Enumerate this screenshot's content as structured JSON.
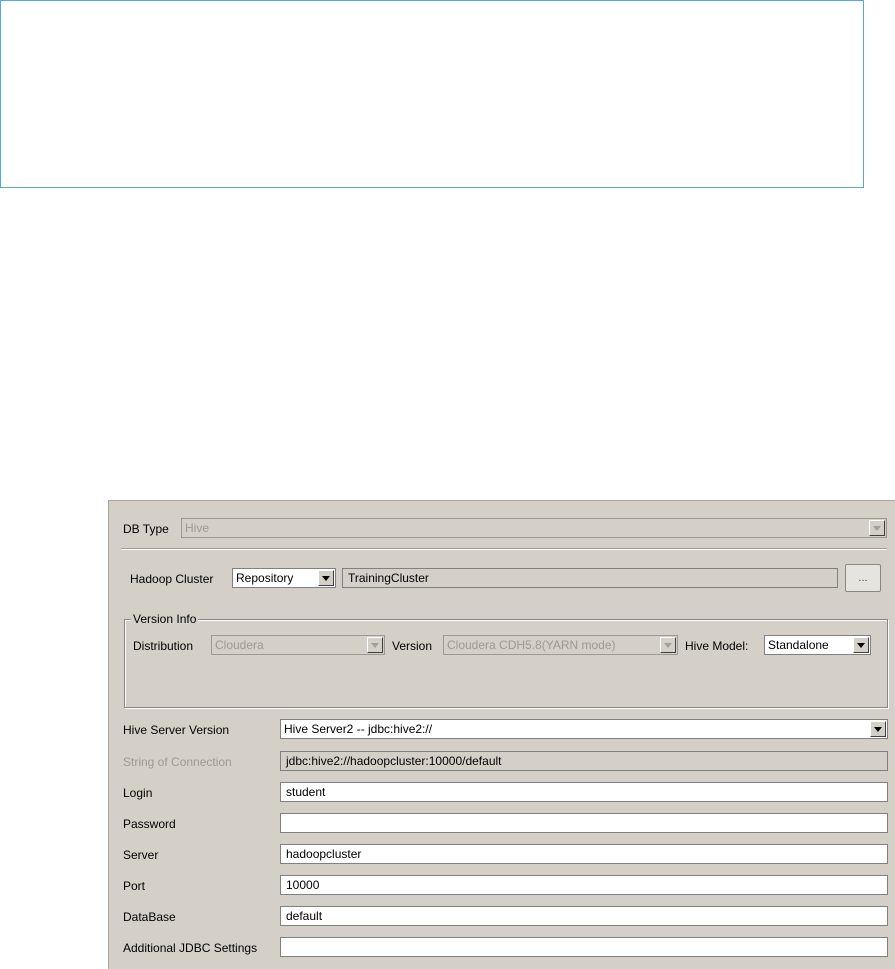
{
  "form": {
    "db_type": {
      "label": "DB Type",
      "value": "Hive"
    },
    "hadoop_cluster": {
      "label": "Hadoop Cluster",
      "mode": "Repository",
      "cluster": "TrainingCluster",
      "browse": "..."
    },
    "version_info": {
      "title": "Version Info",
      "distribution_label": "Distribution",
      "distribution": "Cloudera",
      "version_label": "Version",
      "version": "Cloudera CDH5.8(YARN mode)",
      "hive_model_label": "Hive Model:",
      "hive_model": "Standalone"
    },
    "hive_server_version": {
      "label": "Hive Server Version",
      "value": "Hive Server2 -- jdbc:hive2://"
    },
    "connection_string": {
      "label": "String of Connection",
      "value": "jdbc:hive2://hadoopcluster:10000/default"
    },
    "login": {
      "label": "Login",
      "value": "student"
    },
    "password": {
      "label": "Password",
      "value": ""
    },
    "server": {
      "label": "Server",
      "value": "hadoopcluster"
    },
    "port": {
      "label": "Port",
      "value": "10000"
    },
    "database": {
      "label": "DataBase",
      "value": "default"
    },
    "jdbc_settings": {
      "label": "Additional JDBC Settings",
      "value": ""
    }
  }
}
